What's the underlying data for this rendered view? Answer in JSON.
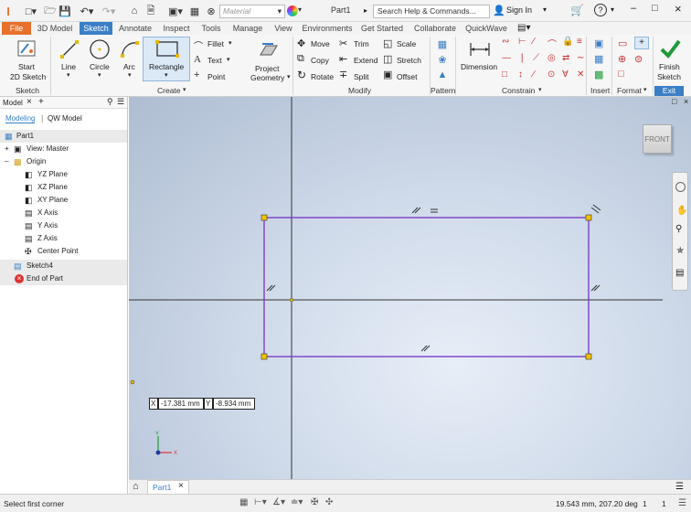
{
  "app": {
    "logo": "I",
    "material_placeholder": "Material",
    "doc_title": "Part1",
    "search_placeholder": "Search Help & Commands...",
    "sign_in": "Sign In"
  },
  "tabs": [
    "File",
    "3D Model",
    "Sketch",
    "Annotate",
    "Inspect",
    "Tools",
    "Manage",
    "View",
    "Environments",
    "Get Started",
    "Collaborate",
    "QuickWave"
  ],
  "ribbon": {
    "start_sketch": [
      "Start",
      "2D Sketch"
    ],
    "line": "Line",
    "circle": "Circle",
    "arc": "Arc",
    "rectangle": "Rectangle",
    "fillet": "Fillet",
    "text": "Text",
    "point": "Point",
    "project_geometry": [
      "Project",
      "Geometry"
    ],
    "move": "Move",
    "copy": "Copy",
    "rotate": "Rotate",
    "trim": "Trim",
    "extend": "Extend",
    "split": "Split",
    "scale": "Scale",
    "stretch": "Stretch",
    "offset": "Offset",
    "dimension": "Dimension",
    "finish_sketch": [
      "Finish",
      "Sketch"
    ],
    "exit": "Exit",
    "panels": {
      "sketch": "Sketch",
      "create": "Create",
      "modify": "Modify",
      "pattern": "Pattern",
      "constrain": "Constrain",
      "insert": "Insert",
      "format": "Format"
    }
  },
  "browser": {
    "title": "Model",
    "tab_modeling": "Modeling",
    "tab_qw": "QW Model",
    "tree": [
      "Part1",
      "View: Master",
      "Origin",
      "YZ Plane",
      "XZ Plane",
      "XY Plane",
      "X Axis",
      "Y Axis",
      "Z Axis",
      "Center Point",
      "Sketch4",
      "End of Part"
    ]
  },
  "viewcube": {
    "label": "FRONT"
  },
  "coord_input": {
    "x_label": "X",
    "x_value": "-17.381 mm",
    "y_label": "Y",
    "y_value": "-8.934 mm"
  },
  "doc_tab": "Part1",
  "status": {
    "left": "Select first corner",
    "readout": "19.543 mm, 207.20 deg",
    "count1": "1",
    "count2": "1"
  },
  "colors": {
    "accent": "#3a7fc6",
    "file_tab": "#e8702a",
    "sketch_line": "#7b3fc6",
    "finish_green": "#1e9a3a"
  }
}
